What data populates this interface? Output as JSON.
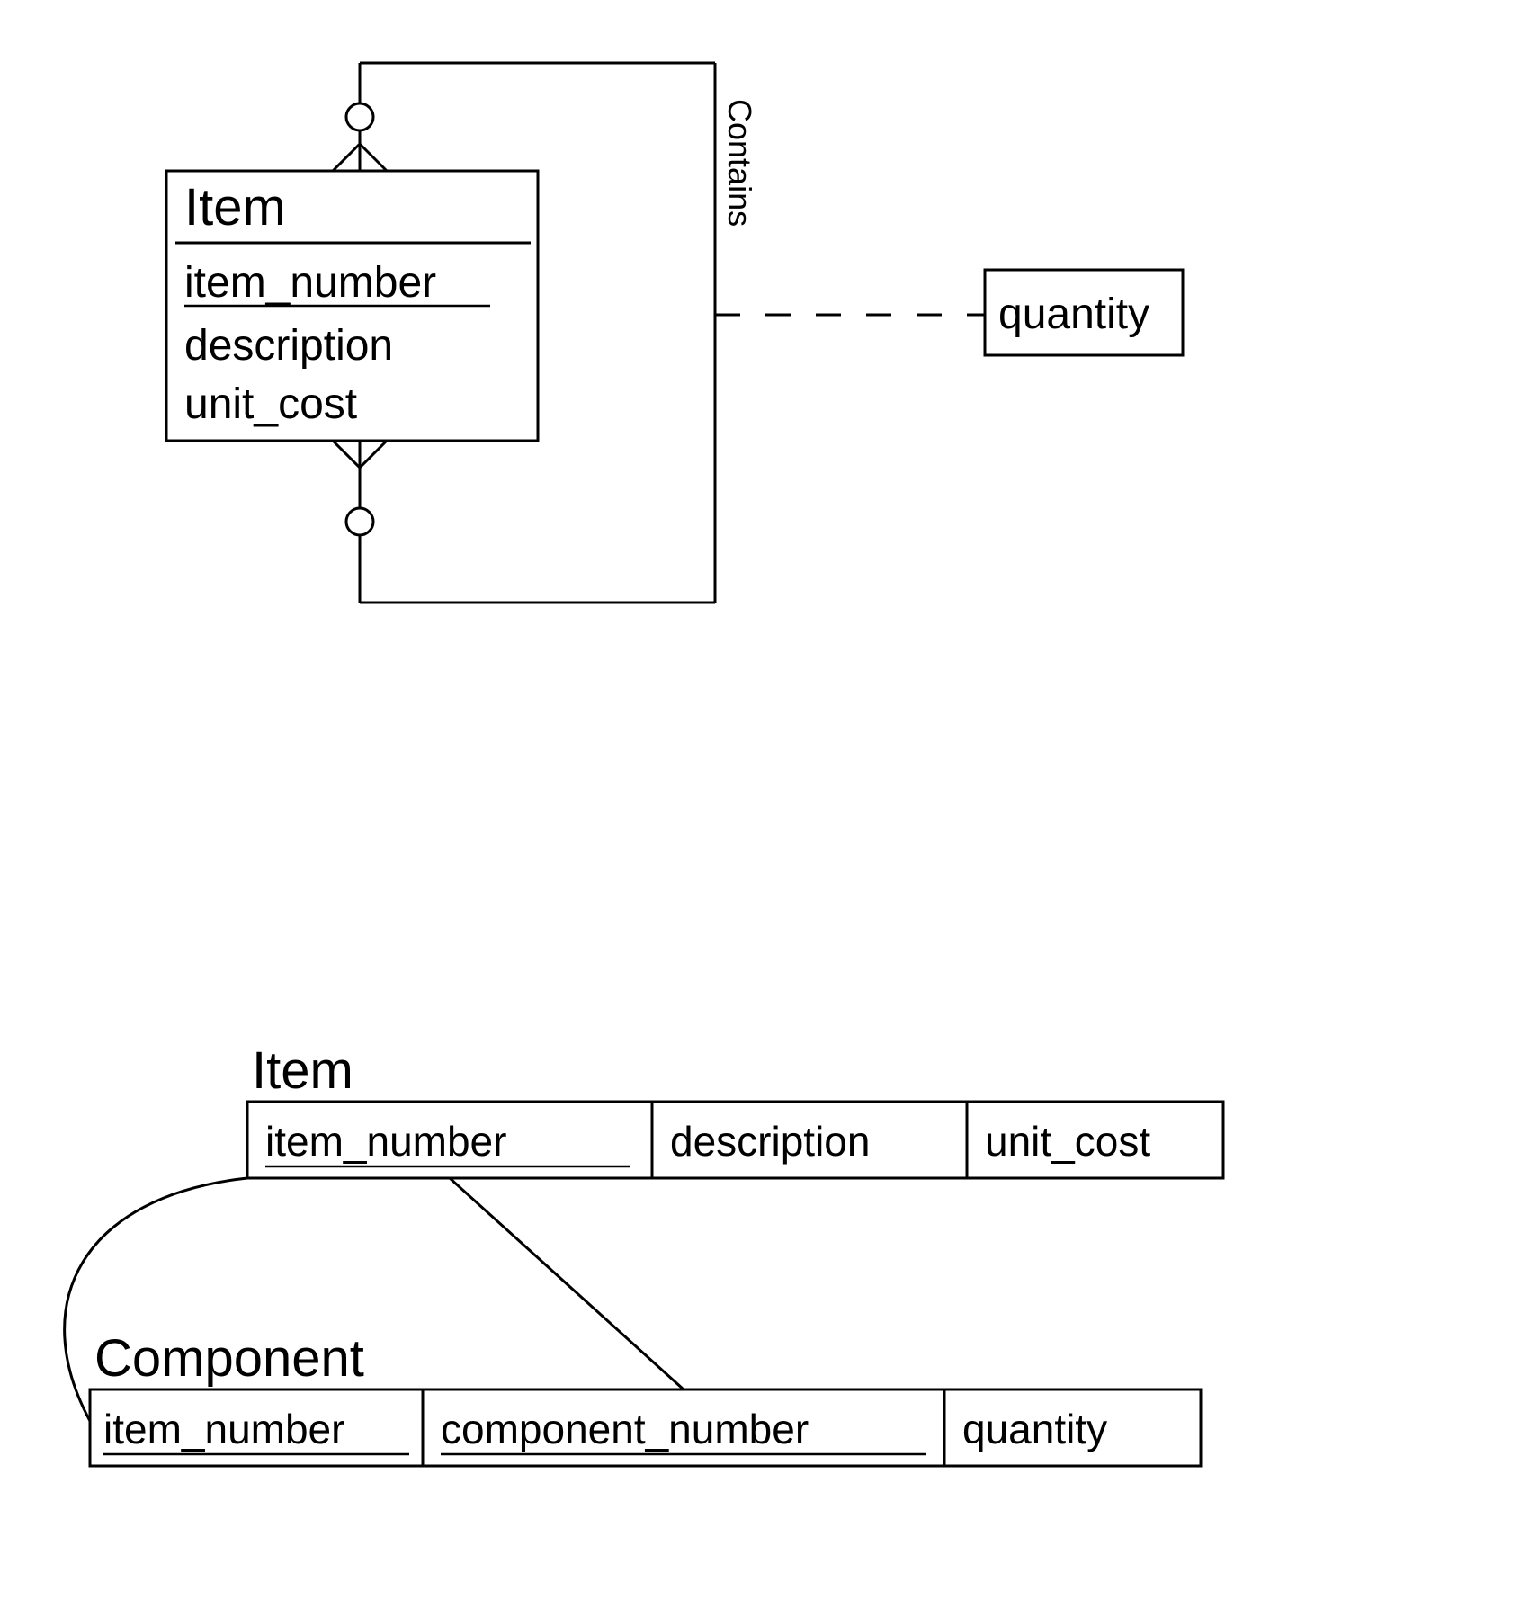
{
  "erd": {
    "entity": {
      "name": "Item",
      "attributes": [
        "item_number",
        "description",
        "unit_cost"
      ],
      "primary_key": "item_number"
    },
    "relationship": {
      "name": "Contains",
      "self_referencing": true,
      "association_attribute": "quantity"
    }
  },
  "relational": {
    "tables": [
      {
        "name": "Item",
        "columns": [
          "item_number",
          "description",
          "unit_cost"
        ],
        "primary_keys": [
          "item_number"
        ]
      },
      {
        "name": "Component",
        "columns": [
          "item_number",
          "component_number",
          "quantity"
        ],
        "primary_keys": [
          "item_number",
          "component_number"
        ]
      }
    ]
  }
}
